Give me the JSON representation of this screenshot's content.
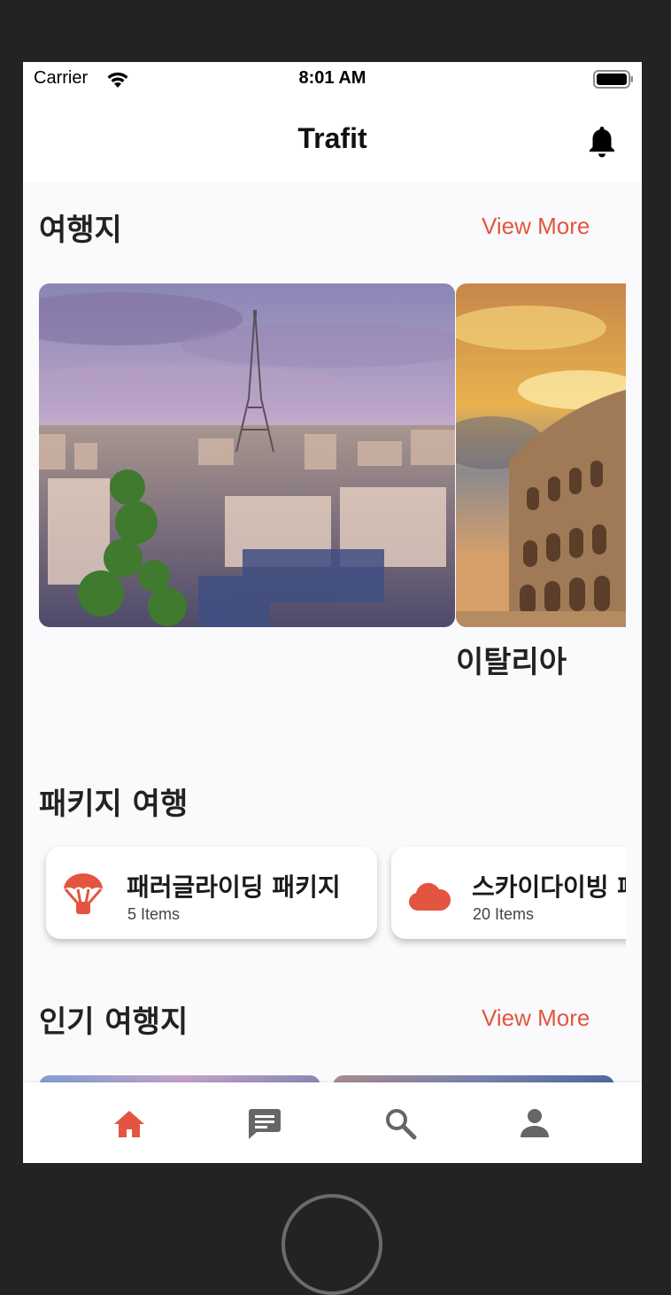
{
  "status_bar": {
    "carrier": "Carrier",
    "time": "8:01 AM"
  },
  "app_bar": {
    "title": "Trafit",
    "notification_icon": "bell-icon"
  },
  "destinations": {
    "title": "여행지",
    "view_more": "View More",
    "cards": [
      {
        "image": "eiffel-tower-paris-photo",
        "name": ""
      },
      {
        "image": "colosseum-rome-photo",
        "name": "이탈리아"
      }
    ]
  },
  "packages": {
    "title": "패키지 여행",
    "items": [
      {
        "icon": "parachute-icon",
        "name": "패러글라이딩 패키지",
        "count": "5 Items"
      },
      {
        "icon": "cloud-icon",
        "name": "스카이다이빙 패키지",
        "count": "20 Items"
      }
    ]
  },
  "popular": {
    "title": "인기 여행지",
    "view_more": "View More"
  },
  "bottom_nav": {
    "items": [
      {
        "icon": "home-icon",
        "active": true
      },
      {
        "icon": "chat-icon",
        "active": false
      },
      {
        "icon": "search-icon",
        "active": false
      },
      {
        "icon": "person-icon",
        "active": false
      }
    ]
  },
  "colors": {
    "accent": "#e35540",
    "background": "#fafafc",
    "nav_inactive": "#666666",
    "device_frame": "#232323"
  }
}
